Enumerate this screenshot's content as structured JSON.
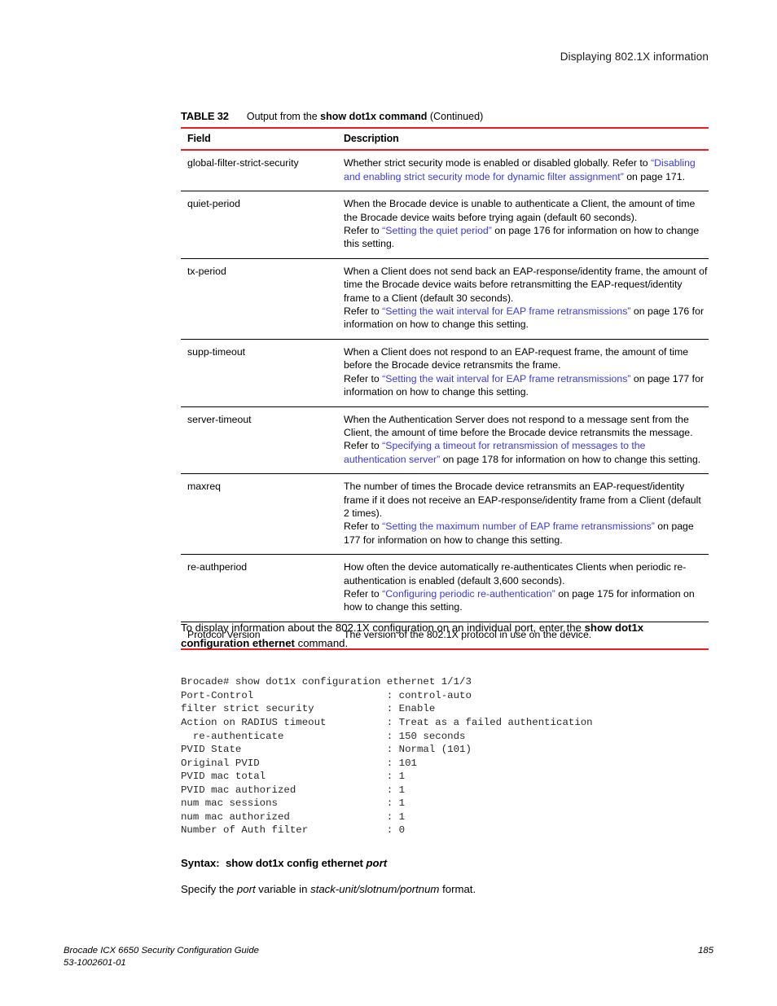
{
  "page": {
    "running_header": "Displaying 802.1X information",
    "footer_guide": "Brocade ICX 6650 Security Configuration Guide",
    "footer_docnum": "53-1002601-01",
    "footer_page_number": "185",
    "accent_red": "#ed1c24",
    "link_blue": "#3a3ae0"
  },
  "table": {
    "label": "TABLE 32",
    "title_prefix": "Output from the ",
    "title_command": "show dot1x command",
    "title_suffix": " (Continued)",
    "headers": {
      "field": "Field",
      "description": "Description"
    },
    "rows": [
      {
        "field": "global-filter-strict-security",
        "p1_a": "Whether strict security mode is enabled or disabled globally. Refer to ",
        "p1_quote_open": "“",
        "p1_link": "Disabling and enabling strict security mode  for dynamic filter assignment",
        "p1_quote_close": "”",
        "p1_b": " on page 171."
      },
      {
        "field": "quiet-period",
        "p1": "When the Brocade device is unable to authenticate a Client, the amount of time the Brocade device waits before trying again (default 60 seconds).",
        "p2_a": "Refer to ",
        "p2_quote_open": "“",
        "p2_link": "Setting the quiet period",
        "p2_quote_close": "”",
        "p2_b": " on page 176 for information on how to change this setting."
      },
      {
        "field": "tx-period",
        "p1": "When a Client does not send back an EAP-response/identity frame, the amount of time the Brocade device waits before retransmitting the EAP-request/identity frame to a Client (default 30 seconds).",
        "p2_a": "Refer to ",
        "p2_quote_open": "“",
        "p2_link": "Setting the wait interval for EAP frame retransmissions",
        "p2_quote_close": "”",
        "p2_b": " on page 176 for information on how to change this setting."
      },
      {
        "field": "supp-timeout",
        "p1": "When a Client does not respond to an EAP-request frame, the amount of time before the Brocade device retransmits the frame.",
        "p2_a": "Refer to ",
        "p2_quote_open": "“",
        "p2_link": "Setting the wait interval for EAP frame retransmissions",
        "p2_quote_close": "”",
        "p2_b": " on page 177 for information on how to change this setting."
      },
      {
        "field": "server-timeout",
        "p1": "When the Authentication Server does not respond to a message sent from the Client, the amount of time before the Brocade device retransmits the message.",
        "p2_a": "Refer to ",
        "p2_quote_open": "“",
        "p2_link": "Specifying a timeout for retransmission of messages to the authentication server",
        "p2_quote_close": "”",
        "p2_b": " on page 178 for information on how to change this setting."
      },
      {
        "field": "maxreq",
        "p1": "The number of times the Brocade device retransmits an EAP-request/identity frame if it does not receive an EAP-response/identity frame from a Client (default 2 times).",
        "p2_a": "Refer to ",
        "p2_quote_open": "“",
        "p2_link": "Setting the maximum number of EAP frame retransmissions",
        "p2_quote_close": "”",
        "p2_b": " on page 177 for information on how to change this setting."
      },
      {
        "field": "re-authperiod",
        "p1": "How often the device automatically re-authenticates Clients when periodic re-authentication is enabled (default 3,600 seconds).",
        "p2_a": "Refer to ",
        "p2_quote_open": "“",
        "p2_link": "Configuring periodic re-authentication",
        "p2_quote_close": "”",
        "p2_b": " on page 175 for information on how to change this setting."
      },
      {
        "field": "Protocol Version",
        "p1": "The version of the 802.1X protocol in use on the device."
      }
    ]
  },
  "body": {
    "intro_a": "To display information about the 802.1X configuration on an individual port, enter the ",
    "intro_command": "show dot1x configuration ethernet",
    "intro_b": " command."
  },
  "code": {
    "text": "Brocade# show dot1x configuration ethernet 1/1/3\nPort-Control                      : control-auto\nfilter strict security            : Enable\nAction on RADIUS timeout          : Treat as a failed authentication\n  re-authenticate                 : 150 seconds\nPVID State                        : Normal (101)\nOriginal PVID                     : 101\nPVID mac total                    : 1\nPVID mac authorized               : 1\nnum mac sessions                  : 1\nnum mac authorized                : 1\nNumber of Auth filter             : 0"
  },
  "syntax": {
    "label": "Syntax:",
    "command": "show dot1x config ethernet",
    "variable": "port",
    "specify_a": "Specify the ",
    "specify_var": "port",
    "specify_b": " variable in ",
    "specify_format": "stack-unit/slotnum/portnum",
    "specify_c": " format."
  }
}
